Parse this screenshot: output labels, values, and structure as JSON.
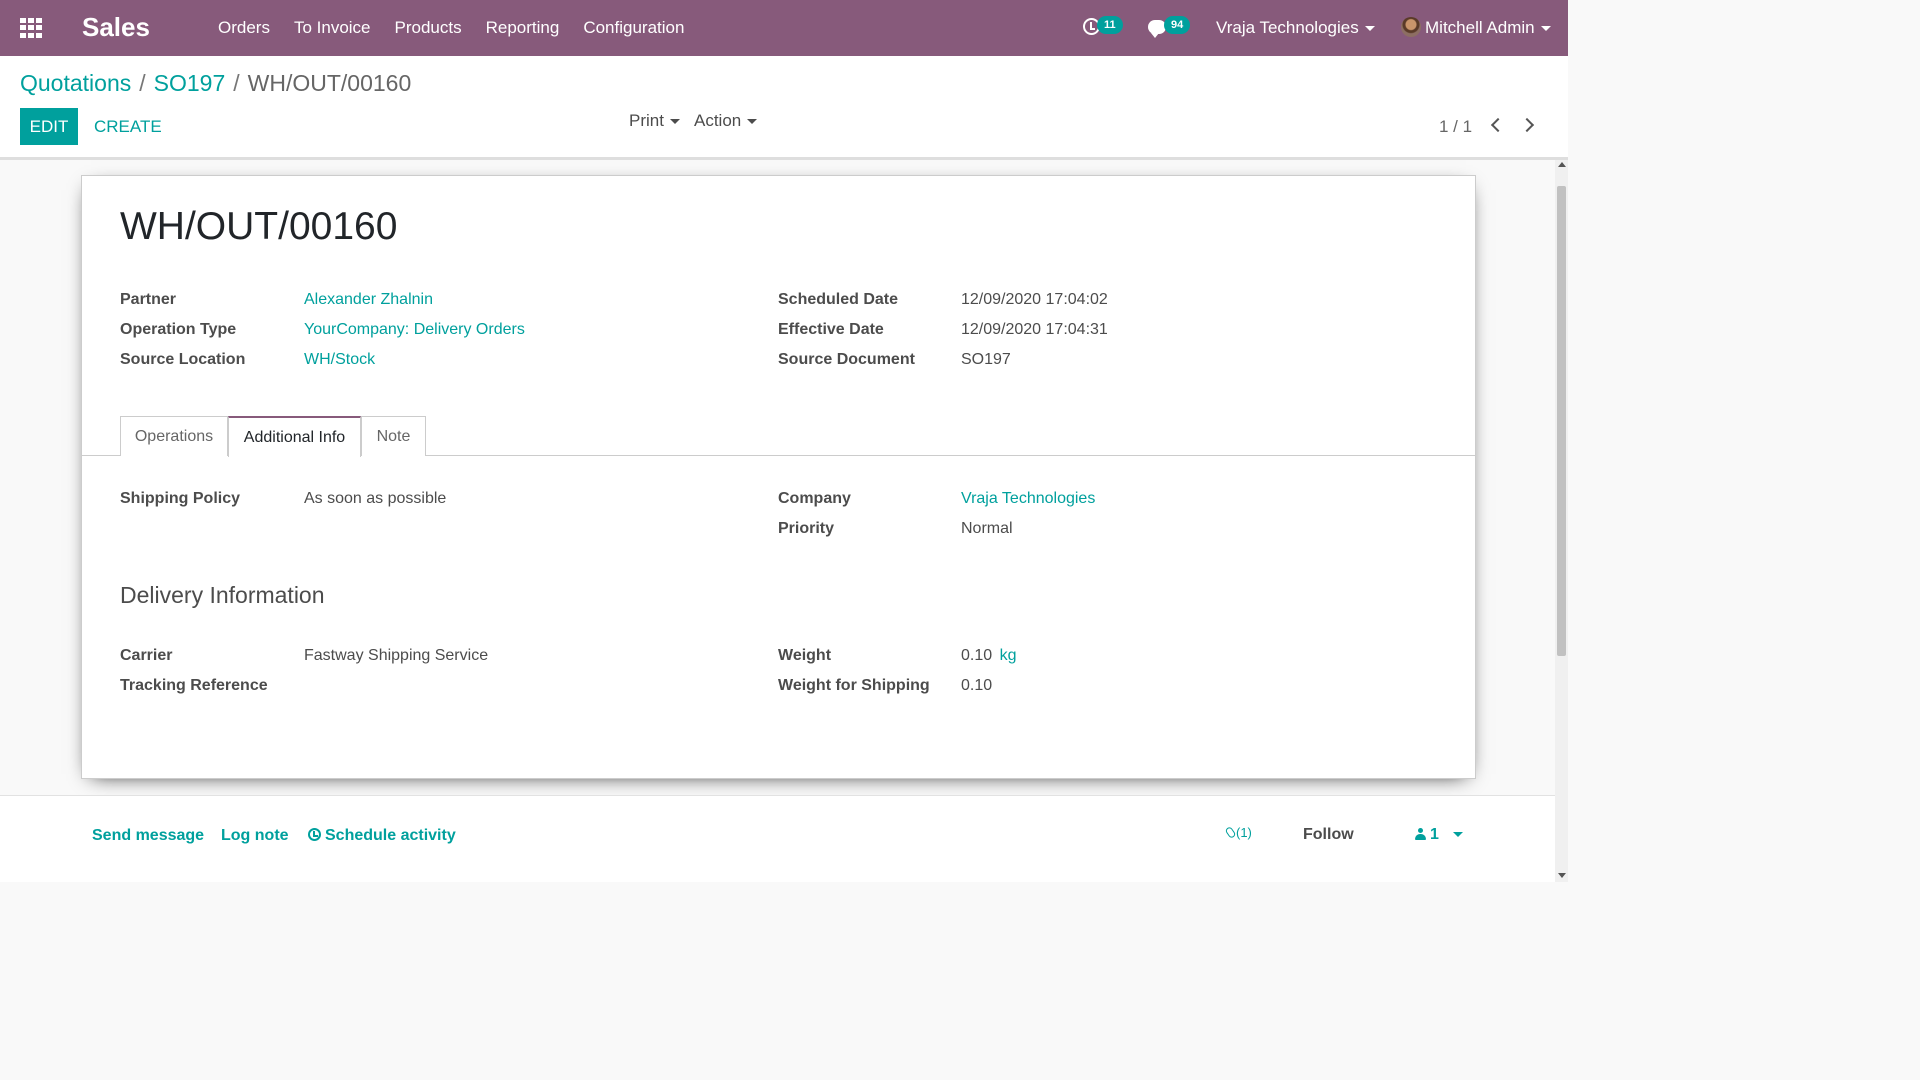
{
  "navbar": {
    "app_name": "Sales",
    "menu": [
      "Orders",
      "To Invoice",
      "Products",
      "Reporting",
      "Configuration"
    ],
    "activity_count": "11",
    "messages_count": "94",
    "company": "Vraja Technologies",
    "user": "Mitchell Admin",
    "colors": {
      "bar": "#875a7b",
      "badge": "#00a09d"
    }
  },
  "breadcrumb": {
    "root": "Quotations",
    "order": "SO197",
    "current": "WH/OUT/00160",
    "separator": "/"
  },
  "buttons": {
    "edit": "EDIT",
    "create": "CREATE",
    "print": "Print",
    "action": "Action"
  },
  "pager": {
    "value": "1 / 1"
  },
  "record": {
    "title": "WH/OUT/00160",
    "left_fields": [
      {
        "label": "Partner",
        "value": "Alexander Zhalnin"
      },
      {
        "label": "Operation Type",
        "value": "YourCompany: Delivery Orders"
      },
      {
        "label": "Source Location",
        "value": "WH/Stock"
      }
    ],
    "right_fields": [
      {
        "label": "Scheduled Date",
        "value": "12/09/2020 17:04:02"
      },
      {
        "label": "Effective Date",
        "value": "12/09/2020 17:04:31"
      },
      {
        "label": "Source Document",
        "value": "SO197"
      }
    ]
  },
  "tabs": [
    {
      "label": "Operations",
      "active": false
    },
    {
      "label": "Additional Info",
      "active": true
    },
    {
      "label": "Note",
      "active": false
    }
  ],
  "additional_info": {
    "shipping_policy_label": "Shipping Policy",
    "shipping_policy": "As soon as possible",
    "company_label": "Company",
    "company": "Vraja Technologies",
    "priority_label": "Priority",
    "priority": "Normal"
  },
  "delivery": {
    "title": "Delivery Information",
    "carrier_label": "Carrier",
    "carrier": "Fastway Shipping Service",
    "tracking_label": "Tracking Reference",
    "tracking": "",
    "weight_label": "Weight",
    "weight": "0.10",
    "weight_unit": "kg",
    "weight_shipping_label": "Weight for Shipping",
    "weight_shipping": "0.10"
  },
  "chatter": {
    "send_message": "Send message",
    "log_note": "Log note",
    "schedule_activity": "Schedule activity",
    "attachments": "(1)",
    "follow": "Follow",
    "followers": "1"
  }
}
